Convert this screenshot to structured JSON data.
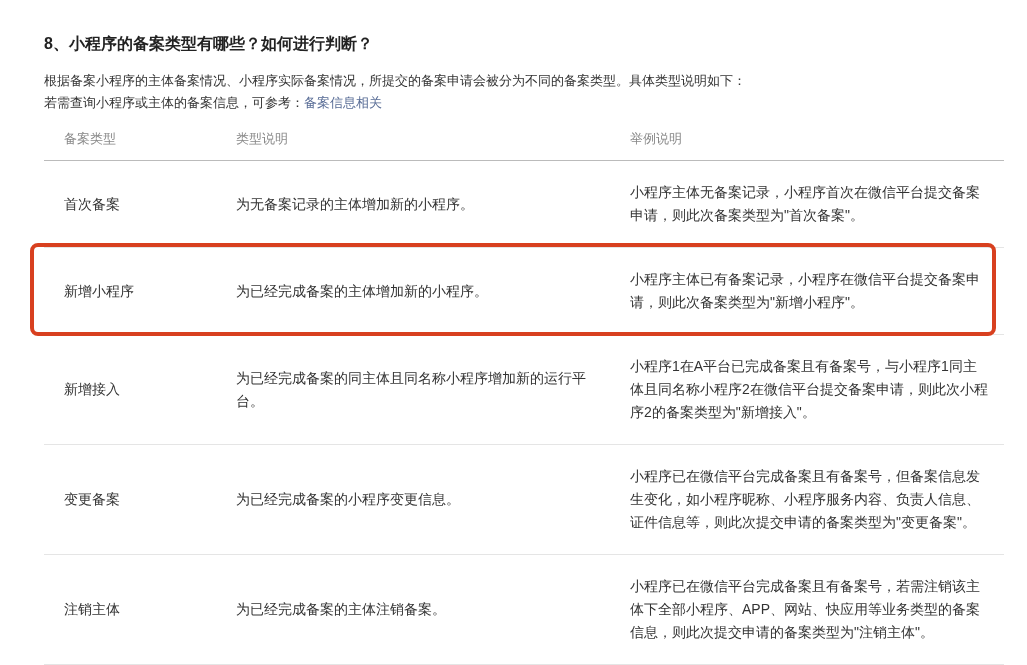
{
  "heading": "8、小程序的备案类型有哪些？如何进行判断？",
  "intro": "根据备案小程序的主体备案情况、小程序实际备案情况，所提交的备案申请会被分为不同的备案类型。具体类型说明如下：",
  "reference": {
    "text": "若需查询小程序或主体的备案信息，可参考：",
    "link": "备案信息相关"
  },
  "table": {
    "columns": [
      "备案类型",
      "类型说明",
      "举例说明"
    ],
    "rows": [
      {
        "type": "首次备案",
        "description": "为无备案记录的主体增加新的小程序。",
        "example": "小程序主体无备案记录，小程序首次在微信平台提交备案申请，则此次备案类型为\"首次备案\"。",
        "highlighted": false
      },
      {
        "type": "新增小程序",
        "description": "为已经完成备案的主体增加新的小程序。",
        "example": "小程序主体已有备案记录，小程序在微信平台提交备案申请，则此次备案类型为\"新增小程序\"。",
        "highlighted": true
      },
      {
        "type": "新增接入",
        "description": "为已经完成备案的同主体且同名称小程序增加新的运行平台。",
        "example": "小程序1在A平台已完成备案且有备案号，与小程序1同主体且同名称小程序2在微信平台提交备案申请，则此次小程序2的备案类型为\"新增接入\"。",
        "highlighted": false
      },
      {
        "type": "变更备案",
        "description": "为已经完成备案的小程序变更信息。",
        "example": "小程序已在微信平台完成备案且有备案号，但备案信息发生变化，如小程序昵称、小程序服务内容、负责人信息、证件信息等，则此次提交申请的备案类型为\"变更备案\"。",
        "highlighted": false
      },
      {
        "type": "注销主体",
        "description": "为已经完成备案的主体注销备案。",
        "example": "小程序已在微信平台完成备案且有备案号，若需注销该主体下全部小程序、APP、网站、快应用等业务类型的备案信息，则此次提交申请的备案类型为\"注销主体\"。",
        "highlighted": false
      }
    ]
  }
}
